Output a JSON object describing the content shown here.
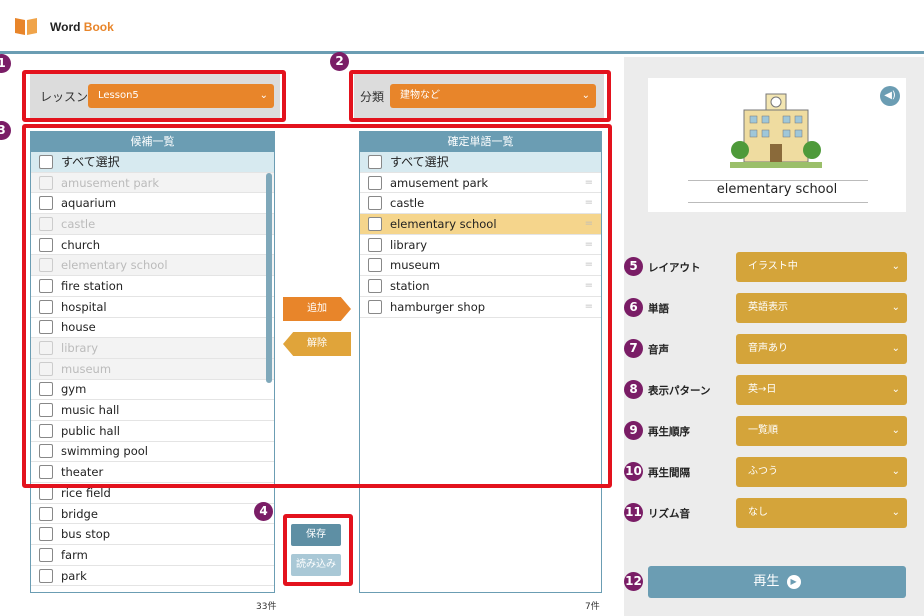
{
  "app": {
    "title_prefix": "Word ",
    "title_accent": "Book"
  },
  "lesson": {
    "label": "レッスン",
    "value": "Lesson5"
  },
  "category": {
    "label": "分類",
    "value": "建物など"
  },
  "candidates": {
    "header": "候補一覧",
    "select_all": "すべて選択",
    "count": "33件",
    "items": [
      {
        "label": "amusement park",
        "disabled": true
      },
      {
        "label": "aquarium",
        "disabled": false
      },
      {
        "label": "castle",
        "disabled": true
      },
      {
        "label": "church",
        "disabled": false
      },
      {
        "label": "elementary school",
        "disabled": true
      },
      {
        "label": "fire station",
        "disabled": false
      },
      {
        "label": "hospital",
        "disabled": false
      },
      {
        "label": "house",
        "disabled": false
      },
      {
        "label": "library",
        "disabled": true
      },
      {
        "label": "museum",
        "disabled": true
      },
      {
        "label": "gym",
        "disabled": false
      },
      {
        "label": "music hall",
        "disabled": false
      },
      {
        "label": "public hall",
        "disabled": false
      },
      {
        "label": "swimming pool",
        "disabled": false
      },
      {
        "label": "theater",
        "disabled": false
      },
      {
        "label": "rice field",
        "disabled": false
      },
      {
        "label": "bridge",
        "disabled": false
      },
      {
        "label": "bus stop",
        "disabled": false
      },
      {
        "label": "farm",
        "disabled": false
      },
      {
        "label": "park",
        "disabled": false
      }
    ]
  },
  "confirmed": {
    "header": "確定単語一覧",
    "select_all": "すべて選択",
    "count": "7件",
    "items": [
      {
        "label": "amusement park",
        "highlighted": false
      },
      {
        "label": "castle",
        "highlighted": false
      },
      {
        "label": "elementary school",
        "highlighted": true
      },
      {
        "label": "library",
        "highlighted": false
      },
      {
        "label": "museum",
        "highlighted": false
      },
      {
        "label": "station",
        "highlighted": false
      },
      {
        "label": "hamburger shop",
        "highlighted": false
      }
    ],
    "drag_glyph": "="
  },
  "actions": {
    "add": "追加",
    "remove": "解除",
    "save": "保存",
    "load": "読み込み"
  },
  "card": {
    "word": "elementary school",
    "speaker_glyph": "◀)"
  },
  "settings": [
    {
      "num": "5",
      "label": "レイアウト",
      "value": "イラスト中"
    },
    {
      "num": "6",
      "label": "単語",
      "value": "英語表示"
    },
    {
      "num": "7",
      "label": "音声",
      "value": "音声あり"
    },
    {
      "num": "8",
      "label": "表示パターン",
      "value": "英→日"
    },
    {
      "num": "9",
      "label": "再生順序",
      "value": "一覧順"
    },
    {
      "num": "10",
      "label": "再生間隔",
      "value": "ふつう"
    },
    {
      "num": "11",
      "label": "リズム音",
      "value": "なし"
    }
  ],
  "play": {
    "num": "12",
    "label": "再生"
  },
  "callouts": [
    "1",
    "2",
    "3",
    "4"
  ],
  "colors": {
    "accent_orange": "#e8852a",
    "blue": "#6b9db3",
    "gold": "#d4a43a",
    "callout": "#7a1d66",
    "red_box": "#e3121d"
  }
}
